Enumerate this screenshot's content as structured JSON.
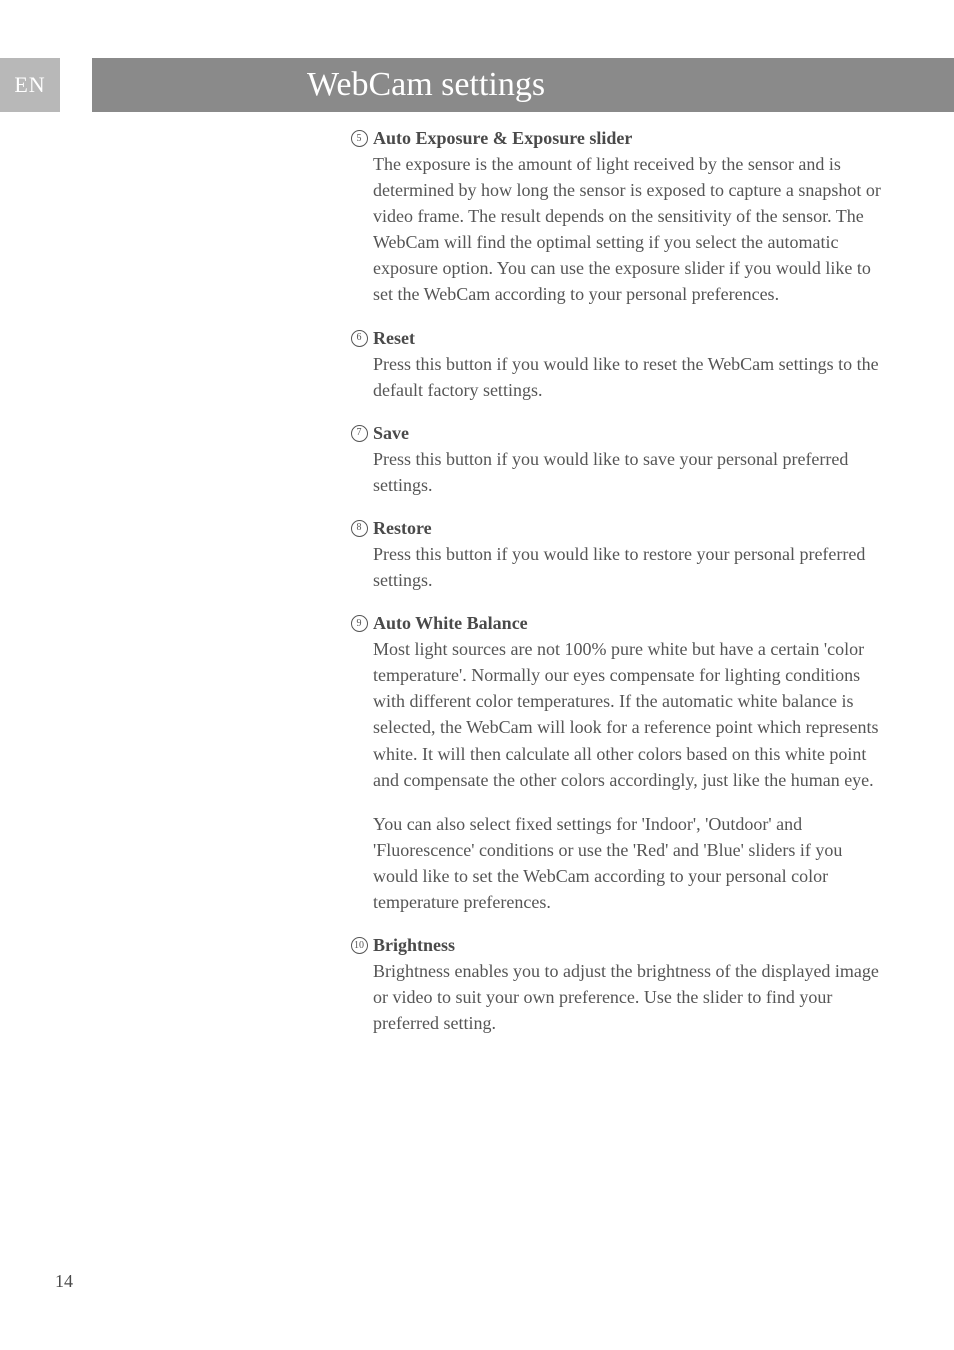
{
  "lang": "EN",
  "title": "WebCam settings",
  "items": [
    {
      "num": "5",
      "title": "Auto Exposure & Exposure slider",
      "paras": [
        "The exposure is the amount of light received by the sensor and is determined by how long the sensor is exposed to capture a snapshot or video frame. The result depends on the sensitivity of the sensor. The WebCam will find the optimal setting if you select the automatic exposure option. You can use the exposure slider if you would like to set the WebCam according to your personal preferences."
      ]
    },
    {
      "num": "6",
      "title": "Reset",
      "paras": [
        "Press this button if you would like to reset the WebCam settings to the default factory settings."
      ]
    },
    {
      "num": "7",
      "title": "Save",
      "paras": [
        "Press this button if you would like to save your personal preferred settings."
      ]
    },
    {
      "num": "8",
      "title": "Restore",
      "paras": [
        "Press this button if you would like to restore your personal preferred settings."
      ]
    },
    {
      "num": "9",
      "title": "Auto White Balance",
      "paras": [
        "Most light sources are not 100% pure white but have a certain 'color temperature'. Normally our eyes compensate for lighting conditions with different color temperatures. If the automatic white balance is selected, the WebCam will look for a reference point which represents white. It will then calculate all other colors based on this white point and compensate the other colors accordingly, just like the human eye.",
        "You can also select fixed settings for 'Indoor', 'Outdoor' and 'Fluorescence' conditions or use the 'Red' and 'Blue' sliders if you would like to set the WebCam according to your personal color temperature preferences."
      ]
    },
    {
      "num": "10",
      "title": "Brightness",
      "paras": [
        "Brightness enables you to adjust the brightness of the displayed image or video to suit your own preference. Use the slider to find your preferred setting."
      ]
    }
  ],
  "pageNumber": "14"
}
